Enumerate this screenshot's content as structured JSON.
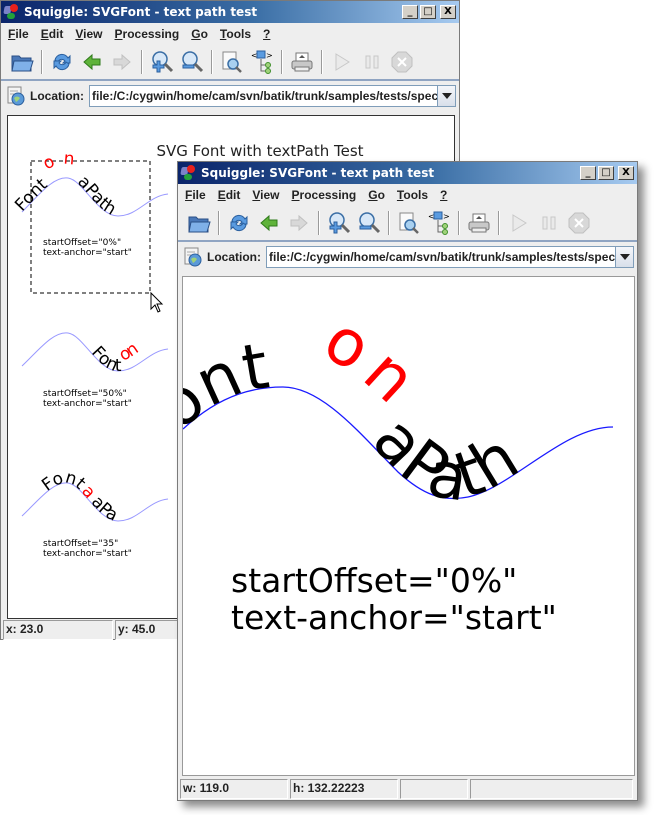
{
  "window_title": "Squiggle: SVGFont - text path test",
  "window_buttons": {
    "minimize": "_",
    "maximize": "□",
    "close": "X"
  },
  "menu": [
    {
      "mn": "F",
      "rest": "ile"
    },
    {
      "mn": "E",
      "rest": "dit"
    },
    {
      "mn": "V",
      "rest": "iew"
    },
    {
      "mn": "P",
      "rest": "rocessing"
    },
    {
      "mn": "G",
      "rest": "o"
    },
    {
      "mn": "T",
      "rest": "ools"
    },
    {
      "mn": "?",
      "rest": ""
    }
  ],
  "toolbar": {
    "icons": [
      "open-folder-icon",
      "reload-icon",
      "back-arrow-icon",
      "forward-arrow-icon",
      "zoom-in-icon",
      "zoom-out-icon",
      "find-icon",
      "dom-viewer-icon",
      "print-icon",
      "play-icon",
      "pause-icon",
      "stop-icon"
    ]
  },
  "location": {
    "label": "Location:",
    "value": "file:/C:/cygwin/home/cam/svn/batik/trunk/samples/tests/spec/"
  },
  "back_window": {
    "document_title": "SVG Font with textPath Test",
    "samples": [
      {
        "path_text": [
          "Font ",
          "on",
          " aPath"
        ],
        "caption1": "startOffset=\"0%\"",
        "caption2": "text-anchor=\"start\""
      },
      {
        "path_text": [
          "Font ",
          "on"
        ],
        "caption1": "startOffset=\"50%\"",
        "caption2": "text-anchor=\"start\""
      },
      {
        "path_text": [
          "Font",
          "a",
          "aPa"
        ],
        "caption1": "startOffset=\"35\"",
        "caption2": "text-anchor=\"start\""
      }
    ],
    "status": {
      "x": "x: 23.0",
      "y": "y: 45.0"
    }
  },
  "front_window": {
    "zoomed_text": {
      "part1": "Font",
      "red": "on",
      "part2": "aPath"
    },
    "caption1": "startOffset=\"0%\"",
    "caption2": "text-anchor=\"start\"",
    "status": {
      "w": "w: 119.0",
      "h": "h: 132.22223",
      "c3": "",
      "c4": ""
    }
  },
  "colors": {
    "path": "#1a1aff",
    "path_light": "#9999ff",
    "highlight": "#ff0000"
  }
}
